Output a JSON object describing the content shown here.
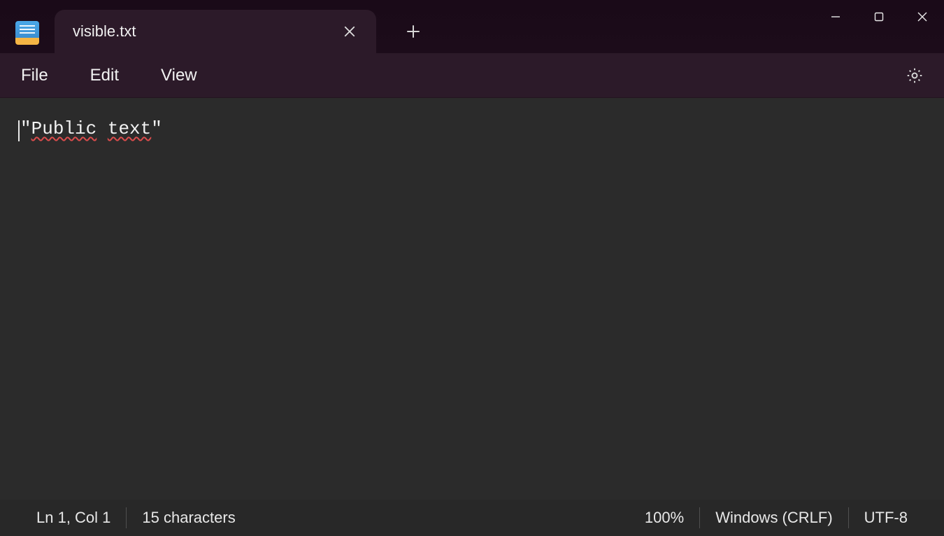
{
  "tab": {
    "title": "visible.txt"
  },
  "menu": {
    "file": "File",
    "edit": "Edit",
    "view": "View"
  },
  "editor": {
    "content": "\"Public text\"",
    "spellchecked_segments": [
      {
        "text": "\"",
        "underline": false
      },
      {
        "text": "Public",
        "underline": true
      },
      {
        "text": " ",
        "underline": false
      },
      {
        "text": "text",
        "underline": true
      },
      {
        "text": "\"",
        "underline": false
      }
    ]
  },
  "status": {
    "position": "Ln 1, Col 1",
    "chars": "15 characters",
    "zoom": "100%",
    "eol": "Windows (CRLF)",
    "encoding": "UTF-8"
  }
}
